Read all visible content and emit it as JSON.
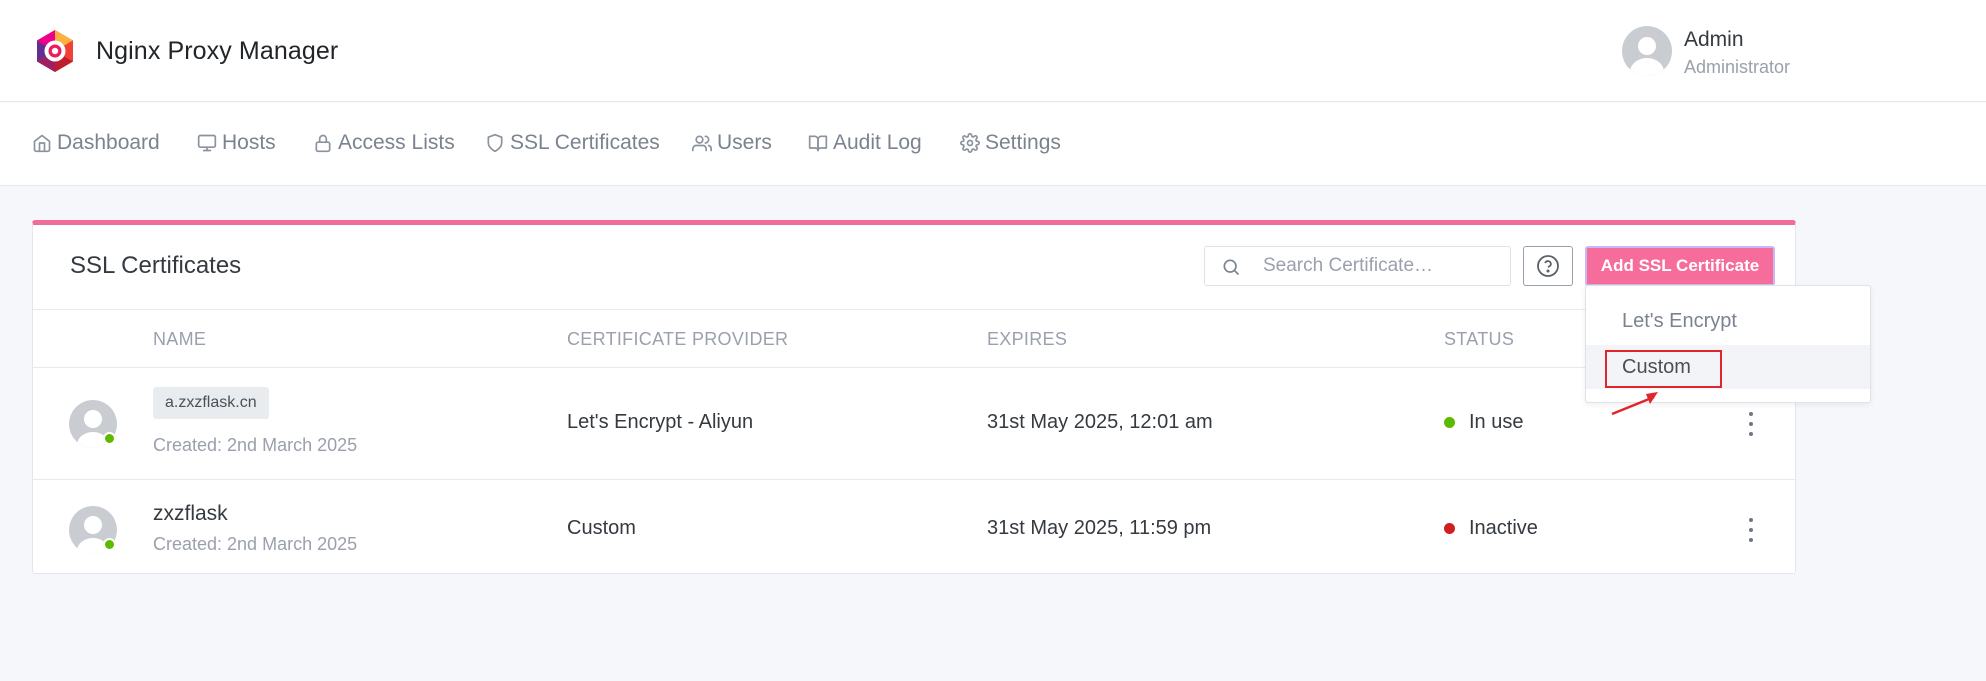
{
  "app": {
    "title": "Nginx Proxy Manager"
  },
  "user": {
    "name": "Admin",
    "role": "Administrator"
  },
  "nav": {
    "items": [
      {
        "label": "Dashboard",
        "icon": "home-icon"
      },
      {
        "label": "Hosts",
        "icon": "monitor-icon"
      },
      {
        "label": "Access Lists",
        "icon": "lock-icon"
      },
      {
        "label": "SSL Certificates",
        "icon": "shield-icon"
      },
      {
        "label": "Users",
        "icon": "users-icon"
      },
      {
        "label": "Audit Log",
        "icon": "book-icon"
      },
      {
        "label": "Settings",
        "icon": "gear-icon"
      }
    ]
  },
  "card": {
    "title": "SSL Certificates",
    "accent_color": "#f06c99",
    "search_placeholder": "Search Certificate…",
    "add_button_label": "Add SSL Certificate",
    "columns": [
      "NAME",
      "CERTIFICATE PROVIDER",
      "EXPIRES",
      "STATUS"
    ],
    "rows": [
      {
        "name": "a.zxzflask.cn",
        "created": "Created: 2nd March 2025",
        "provider": "Let's Encrypt - Aliyun",
        "expires": "31st May 2025, 12:01 am",
        "status": "In use",
        "status_color": "#5eba00"
      },
      {
        "name": "zxzflask",
        "created": "Created: 2nd March 2025",
        "provider": "Custom",
        "expires": "31st May 2025, 11:59 pm",
        "status": "Inactive",
        "status_color": "#cd201f"
      }
    ]
  },
  "dropdown": {
    "items": [
      "Let's Encrypt",
      "Custom"
    ],
    "highlighted": "Custom",
    "highlight_color": "#e0262b"
  }
}
